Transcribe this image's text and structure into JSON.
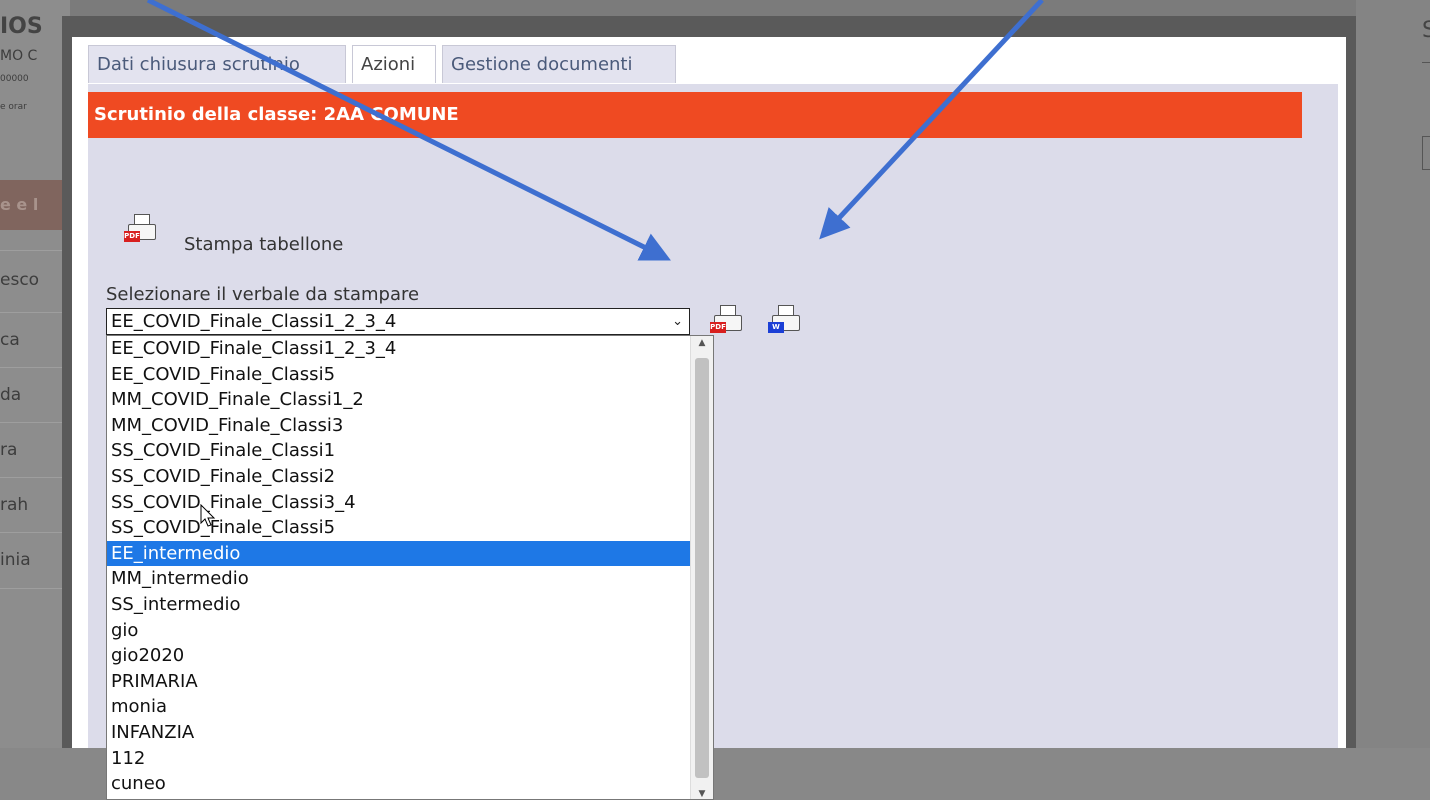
{
  "background": {
    "title": "IOS",
    "subtitle": "MO C",
    "tiny_line_1": "00000",
    "tiny_line_2": "e orar",
    "band_text": "e e l",
    "sidebar_items": [
      "esco",
      "ca",
      "da",
      "ra",
      "rah",
      "inia"
    ],
    "right_letter": "S"
  },
  "tabs": [
    {
      "label": "Dati chiusura scrutinio",
      "active": false
    },
    {
      "label": "Azioni",
      "active": true
    },
    {
      "label": "Gestione documenti",
      "active": false
    }
  ],
  "panel": {
    "header": "Scrutinio della classe: 2AA COMUNE",
    "stampa_tabellone_label": "Stampa tabellone",
    "select_label": "Selezionare il verbale da stampare",
    "selected_value": "EE_COVID_Finale_Classi1_2_3_4",
    "options": [
      "EE_COVID_Finale_Classi1_2_3_4",
      "EE_COVID_Finale_Classi5",
      "MM_COVID_Finale_Classi1_2",
      "MM_COVID_Finale_Classi3",
      "SS_COVID_Finale_Classi1",
      "SS_COVID_Finale_Classi2",
      "SS_COVID_Finale_Classi3_4",
      "SS_COVID_Finale_Classi5",
      "EE_intermedio",
      "MM_intermedio",
      "SS_intermedio",
      "gio",
      "gio2020",
      "PRIMARIA",
      "monia",
      "INFANZIA",
      "112",
      "cuneo"
    ],
    "highlighted_option": "EE_intermedio",
    "print_pdf_badge": "PDF",
    "print_word_badge": "W"
  },
  "colors": {
    "header_bg": "#ef4a22",
    "panel_bg": "#dcdcea",
    "highlight": "#1e78e6",
    "arrow": "#3e6fd0"
  },
  "icons": [
    "pdf-printer-icon",
    "word-printer-icon",
    "chevron-down-icon",
    "mouse-cursor-icon"
  ]
}
